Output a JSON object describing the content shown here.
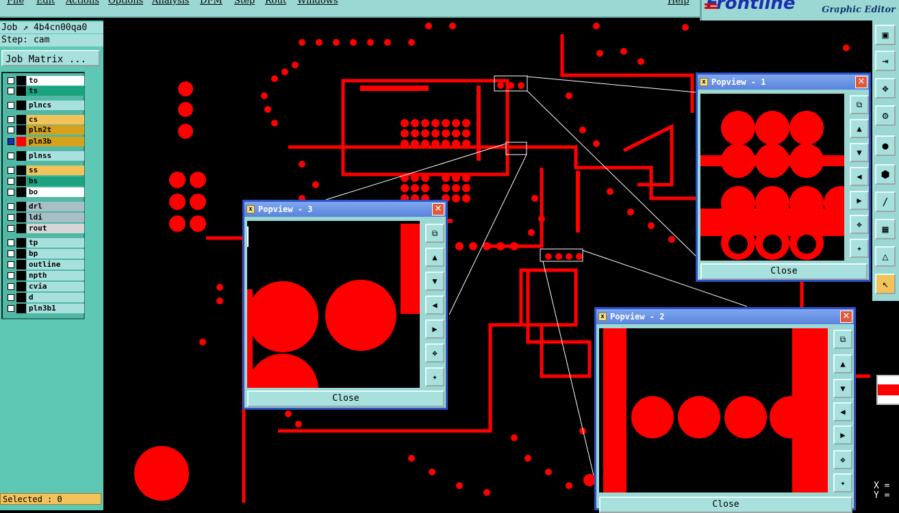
{
  "menu": {
    "items": [
      "File",
      "Edit",
      "Actions",
      "Options",
      "Analysis",
      "DFM",
      "Step",
      "Rout",
      "Windows",
      "Help"
    ]
  },
  "brand": {
    "logo": "Frontline",
    "subtitle": "Graphic Editor"
  },
  "job": {
    "label": "Job",
    "name": "4b4cn00qa0"
  },
  "step": {
    "label": "Step:",
    "name": "cam"
  },
  "job_matrix_label": "Job Matrix ...",
  "layers": [
    {
      "name": "to",
      "color": "#ffffff"
    },
    {
      "name": "ts",
      "color": "#1aa37e"
    },
    {
      "name": "plncs",
      "color": "#a7e0dc"
    },
    {
      "name": "cs",
      "color": "#f2c35b"
    },
    {
      "name": "pln2t",
      "color": "#d7a21a"
    },
    {
      "name": "pln3b",
      "color": "#d7a21a"
    },
    {
      "name": "plnss",
      "color": "#a7e0dc"
    },
    {
      "name": "ss",
      "color": "#f2c35b"
    },
    {
      "name": "bs",
      "color": "#1aa37e"
    },
    {
      "name": "bo",
      "color": "#ffffff"
    },
    {
      "name": "drl",
      "color": "#a9bfc6"
    },
    {
      "name": "ldi",
      "color": "#a9bfc6"
    },
    {
      "name": "rout",
      "color": "#d6d6d6"
    },
    {
      "name": "tp",
      "color": "#a7e0dc"
    },
    {
      "name": "bp",
      "color": "#a7e0dc"
    },
    {
      "name": "outline",
      "color": "#a7e0dc"
    },
    {
      "name": "npth",
      "color": "#a7e0dc"
    },
    {
      "name": "cvia",
      "color": "#a7e0dc"
    },
    {
      "name": "d",
      "color": "#a7e0dc"
    },
    {
      "name": "pln3b1",
      "color": "#a7e0dc"
    }
  ],
  "selected_text": "Selected : 0",
  "coords": {
    "x_label": "X =",
    "y_label": "Y ="
  },
  "popups": [
    {
      "title": "Popview - 1",
      "close_label": "Close"
    },
    {
      "title": "Popview - 2",
      "close_label": "Close"
    },
    {
      "title": "Popview - 3",
      "close_label": "Close"
    }
  ],
  "colors": {
    "copper": "#ff0000",
    "background": "#000000",
    "panel": "#9bd8d3",
    "titlebar": "#2b54c9"
  }
}
